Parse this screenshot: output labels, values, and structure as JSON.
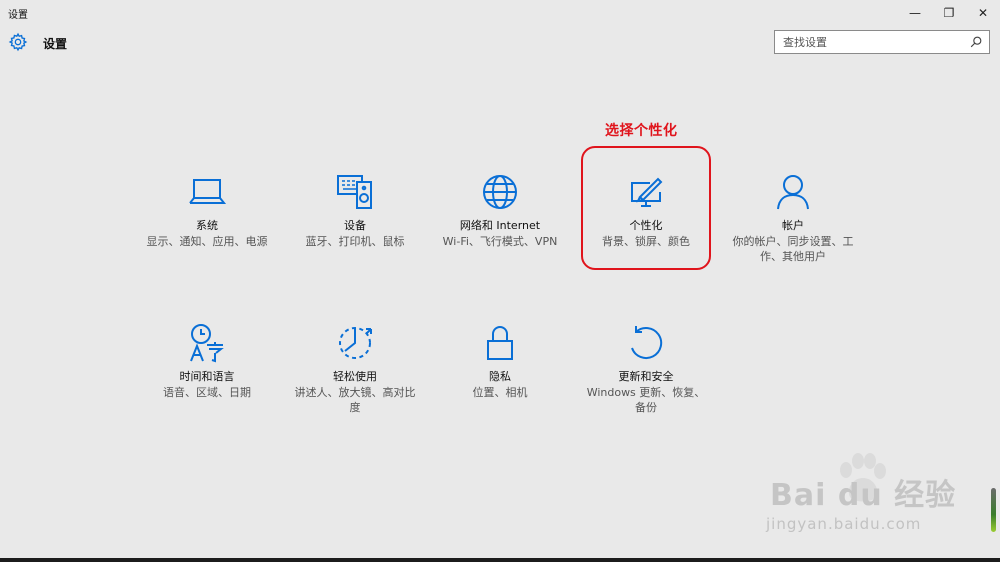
{
  "window": {
    "title": "设置",
    "controls": {
      "minimize": "—",
      "restore": "❐",
      "close": "✕"
    }
  },
  "appbar": {
    "title": "设置",
    "search": {
      "placeholder": "查找设置",
      "value": ""
    }
  },
  "annotation": {
    "text": "选择个性化",
    "color": "#e0141c"
  },
  "accent_color": "#0a6fd6",
  "tiles": [
    {
      "icon": "laptop-icon",
      "name": "系统",
      "desc": "显示、通知、应用、电源"
    },
    {
      "icon": "devices-icon",
      "name": "设备",
      "desc": "蓝牙、打印机、鼠标"
    },
    {
      "icon": "globe-icon",
      "name": "网络和 Internet",
      "desc": "Wi-Fi、飞行模式、VPN"
    },
    {
      "icon": "personalization-icon",
      "name": "个性化",
      "desc": "背景、锁屏、颜色"
    },
    {
      "icon": "person-icon",
      "name": "帐户",
      "desc": "你的帐户、同步设置、工作、其他用户"
    },
    {
      "icon": "time-language-icon",
      "name": "时间和语言",
      "desc": "语音、区域、日期"
    },
    {
      "icon": "ease-of-access-icon",
      "name": "轻松使用",
      "desc": "讲述人、放大镜、高对比度"
    },
    {
      "icon": "lock-icon",
      "name": "隐私",
      "desc": "位置、相机"
    },
    {
      "icon": "update-icon",
      "name": "更新和安全",
      "desc": "Windows 更新、恢复、备份"
    }
  ],
  "watermark": {
    "brand": "Bai du 经验",
    "url": "jingyan.baidu.com"
  }
}
